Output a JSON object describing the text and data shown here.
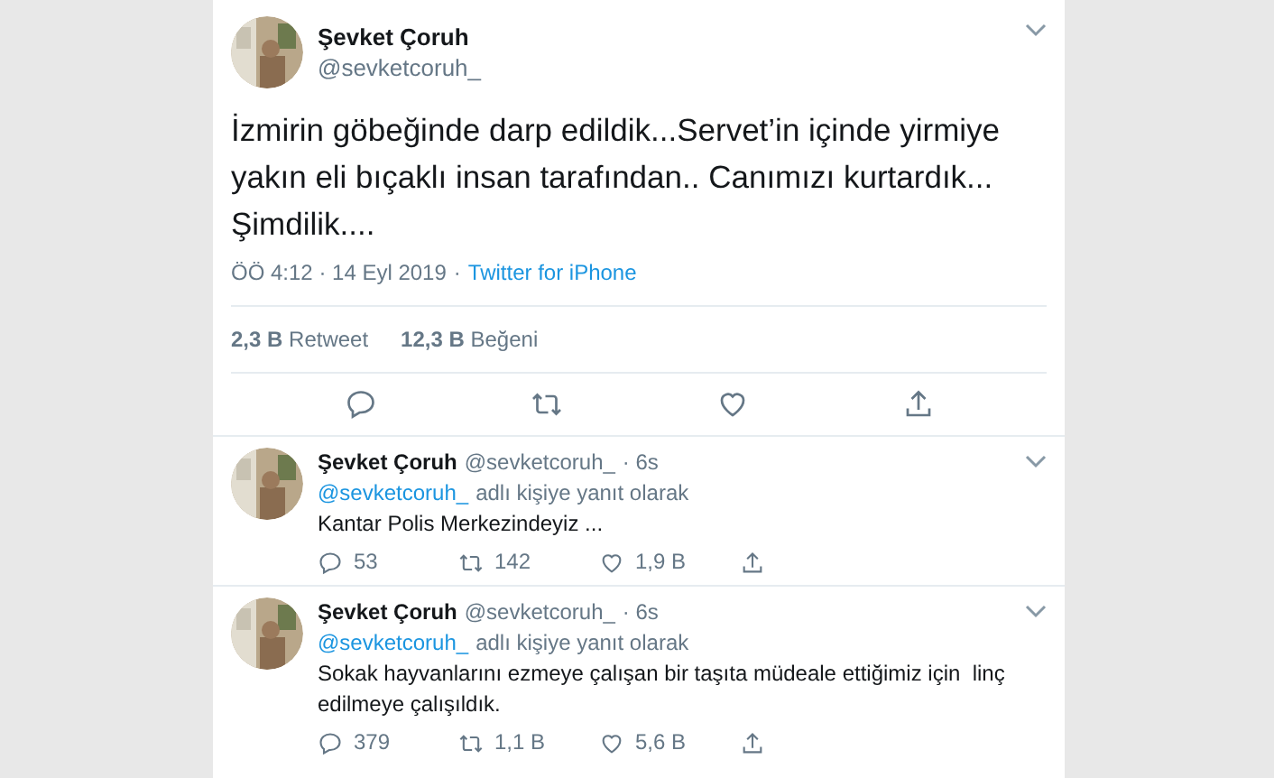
{
  "main_tweet": {
    "author": {
      "name": "Şevket Çoruh",
      "handle": "@sevketcoruh_"
    },
    "text": "İzmirin göbeğinde darp edildik...Servet’in içinde yirmiye yakın eli bıçaklı insan tarafından.. Canımızı kurtardık... Şimdilik....",
    "time": "ÖÖ 4:12 · 14 Eyl 2019",
    "separator": "·",
    "source": "Twitter for iPhone",
    "stats": [
      {
        "count": "2,3 B",
        "label": "Retweet"
      },
      {
        "count": "12,3 B",
        "label": "Beğeni"
      }
    ]
  },
  "replies": [
    {
      "name": "Şevket Çoruh",
      "handle": "@sevketcoruh_",
      "age": "· 6s",
      "reply_to": "@sevketcoruh_",
      "reply_note": "adlı kişiye yanıt olarak",
      "text": "Kantar Polis Merkezindeyiz ...",
      "replies": "53",
      "retweets": "142",
      "likes": "1,9 B"
    },
    {
      "name": "Şevket Çoruh",
      "handle": "@sevketcoruh_",
      "age": "· 6s",
      "reply_to": "@sevketcoruh_",
      "reply_note": "adlı kişiye yanıt olarak",
      "text": "Sokak hayvanlarını ezmeye çalışan bir taşıta müdeale ettiğimiz için  linç edilmeye çalışıldık.",
      "replies": "379",
      "retweets": "1,1 B",
      "likes": "5,6 B"
    }
  ]
}
